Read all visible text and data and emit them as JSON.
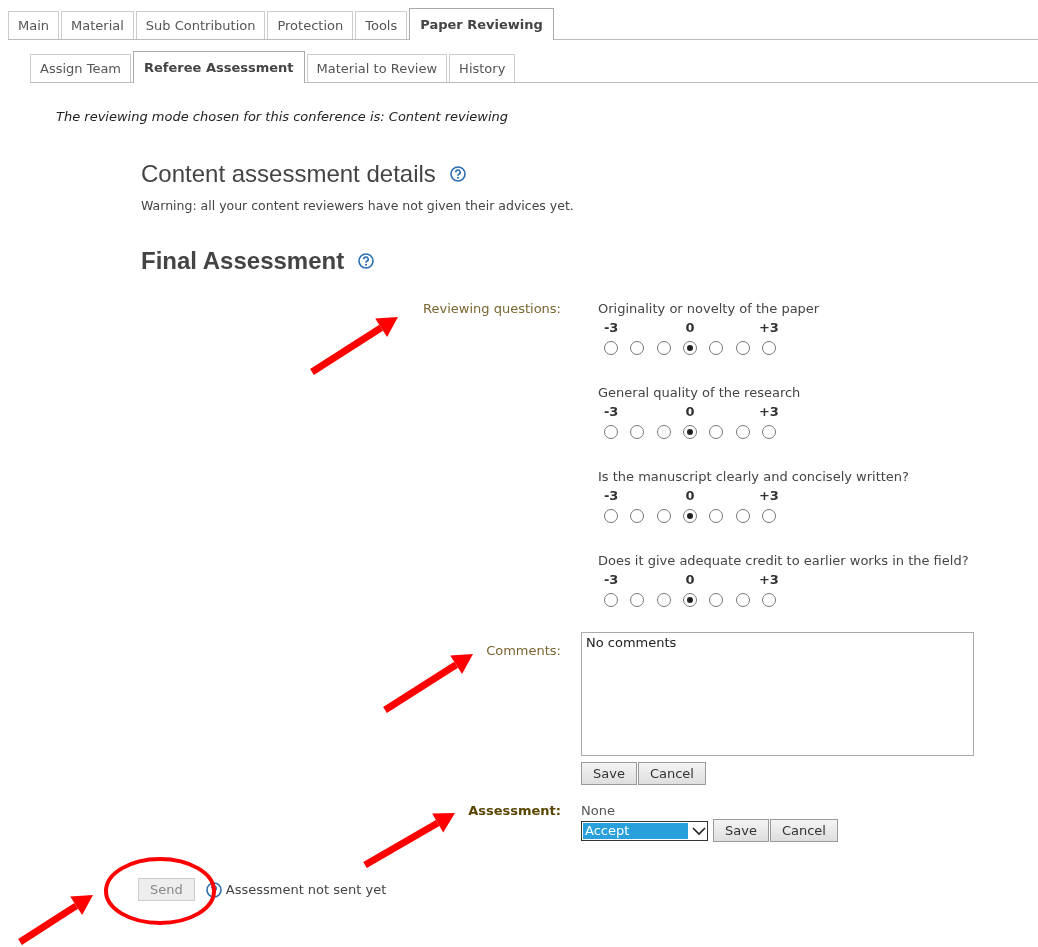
{
  "tabs": [
    {
      "label": "Main",
      "selected": false
    },
    {
      "label": "Material",
      "selected": false
    },
    {
      "label": "Sub Contribution",
      "selected": false
    },
    {
      "label": "Protection",
      "selected": false
    },
    {
      "label": "Tools",
      "selected": false
    },
    {
      "label": "Paper Reviewing",
      "selected": true
    }
  ],
  "subtabs": [
    {
      "label": "Assign Team",
      "selected": false
    },
    {
      "label": "Referee Assessment",
      "selected": true
    },
    {
      "label": "Material to Review",
      "selected": false
    },
    {
      "label": "History",
      "selected": false
    }
  ],
  "mode_note": "The reviewing mode chosen for this conference is: Content reviewing",
  "details": {
    "title": "Content assessment details",
    "warning": "Warning: all your content reviewers have not given their advices yet."
  },
  "final": {
    "title": "Final Assessment",
    "questions_label": "Reviewing questions:",
    "questions": [
      {
        "text": "Originality or novelty of the paper",
        "scale_labels": [
          "-3",
          "0",
          "+3"
        ],
        "options": [
          {
            "selected": false
          },
          {
            "selected": false
          },
          {
            "selected": false
          },
          {
            "selected": true
          },
          {
            "selected": false
          },
          {
            "selected": false
          },
          {
            "selected": false
          }
        ]
      },
      {
        "text": "General quality of the research",
        "scale_labels": [
          "-3",
          "0",
          "+3"
        ],
        "options": [
          {
            "selected": false
          },
          {
            "selected": false
          },
          {
            "selected": false
          },
          {
            "selected": true
          },
          {
            "selected": false
          },
          {
            "selected": false
          },
          {
            "selected": false
          }
        ]
      },
      {
        "text": "Is the manuscript clearly and concisely written?",
        "scale_labels": [
          "-3",
          "0",
          "+3"
        ],
        "options": [
          {
            "selected": false
          },
          {
            "selected": false
          },
          {
            "selected": false
          },
          {
            "selected": true
          },
          {
            "selected": false
          },
          {
            "selected": false
          },
          {
            "selected": false
          }
        ]
      },
      {
        "text": "Does it give adequate credit to earlier works in the field?",
        "scale_labels": [
          "-3",
          "0",
          "+3"
        ],
        "options": [
          {
            "selected": false
          },
          {
            "selected": false
          },
          {
            "selected": false
          },
          {
            "selected": true
          },
          {
            "selected": false
          },
          {
            "selected": false
          },
          {
            "selected": false
          }
        ]
      }
    ],
    "comments_label": "Comments:",
    "comments_value": "No comments",
    "comments_buttons": [
      "Save",
      "Cancel"
    ],
    "assessment_label": "Assessment:",
    "assessment_current": "None",
    "assessment_choice": "Accept",
    "assessment_buttons": [
      "Save",
      "Cancel"
    ]
  },
  "send": {
    "label": "Send",
    "disabled": true,
    "status": "Assessment not sent yet"
  },
  "annotations": [
    {
      "kind": "arrow"
    },
    {
      "kind": "arrow"
    },
    {
      "kind": "arrow"
    },
    {
      "kind": "arrow"
    },
    {
      "kind": "ellipse"
    }
  ]
}
